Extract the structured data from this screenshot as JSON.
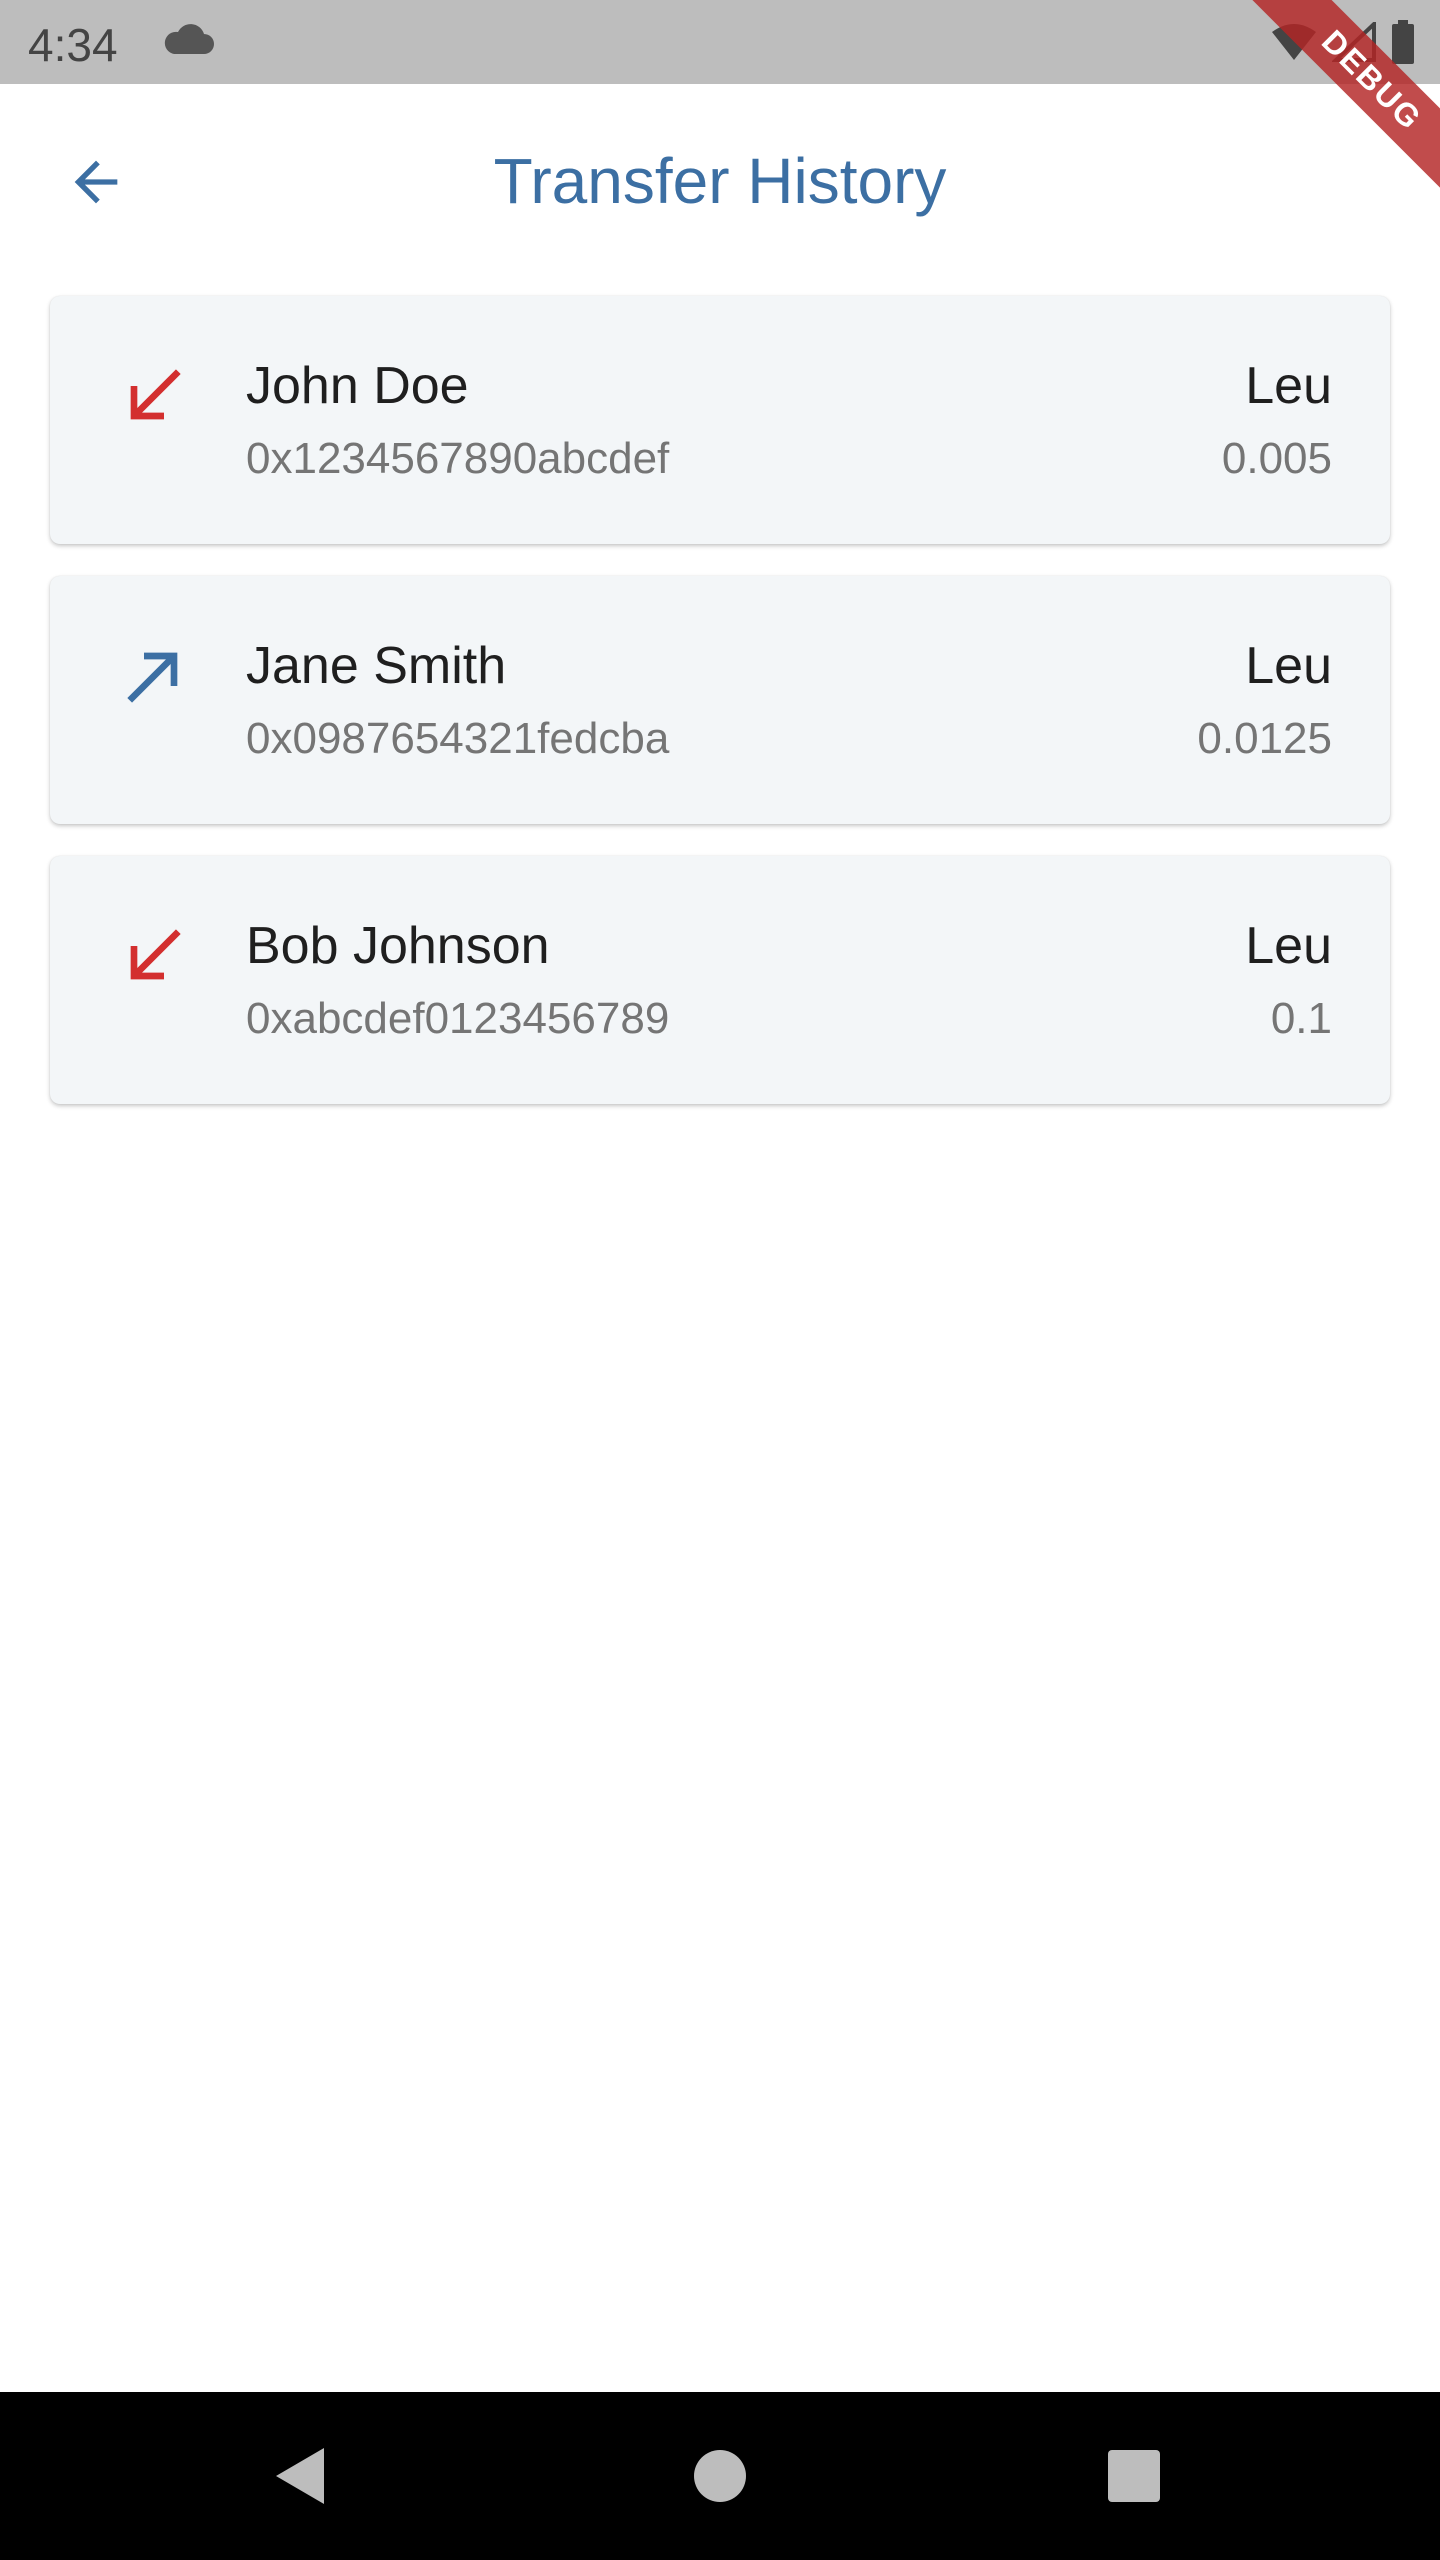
{
  "status_bar": {
    "time": "4:34",
    "icons": [
      "cloud-icon",
      "wifi-icon",
      "signal-icon",
      "battery-icon"
    ]
  },
  "debug_banner": "DEBUG",
  "app_bar": {
    "title": "Transfer History",
    "back_icon": "arrow-back-icon"
  },
  "colors": {
    "accent": "#3c6fa3",
    "incoming": "#d32f2f",
    "outgoing": "#3c6fa3",
    "card_background": "#f3f6f8"
  },
  "transfers": [
    {
      "name": "John Doe",
      "address": "0x1234567890abcdef",
      "currency": "Leu",
      "amount": "0.005",
      "direction": "incoming",
      "icon": "arrow-down-left-icon"
    },
    {
      "name": "Jane Smith",
      "address": "0x0987654321fedcba",
      "currency": "Leu",
      "amount": "0.0125",
      "direction": "outgoing",
      "icon": "arrow-up-right-icon"
    },
    {
      "name": "Bob Johnson",
      "address": "0xabcdef0123456789",
      "currency": "Leu",
      "amount": "0.1",
      "direction": "incoming",
      "icon": "arrow-down-left-icon"
    }
  ],
  "nav_bar": {
    "buttons": [
      "back-triangle-icon",
      "home-circle-icon",
      "recents-square-icon"
    ]
  }
}
